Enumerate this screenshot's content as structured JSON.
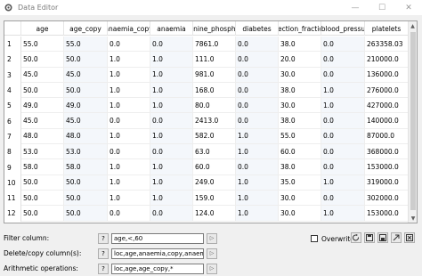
{
  "window": {
    "title": "Data Editor",
    "min": "—",
    "max": "☐",
    "close": "✕"
  },
  "columns": [
    "age",
    "age_copy",
    "anaemia_copy",
    "anaemia",
    "atinine_phosphok",
    "diabetes",
    "ejection_fraction",
    "h_blood_pressure",
    "platelets"
  ],
  "rows": [
    {
      "n": "1",
      "v": [
        "55.0",
        "55.0",
        "0.0",
        "0.0",
        "7861.0",
        "0.0",
        "38.0",
        "0.0",
        "263358.03"
      ]
    },
    {
      "n": "2",
      "v": [
        "50.0",
        "50.0",
        "1.0",
        "1.0",
        "111.0",
        "0.0",
        "20.0",
        "0.0",
        "210000.0"
      ]
    },
    {
      "n": "3",
      "v": [
        "45.0",
        "45.0",
        "1.0",
        "1.0",
        "981.0",
        "0.0",
        "30.0",
        "0.0",
        "136000.0"
      ]
    },
    {
      "n": "4",
      "v": [
        "50.0",
        "50.0",
        "1.0",
        "1.0",
        "168.0",
        "0.0",
        "38.0",
        "1.0",
        "276000.0"
      ]
    },
    {
      "n": "5",
      "v": [
        "49.0",
        "49.0",
        "1.0",
        "1.0",
        "80.0",
        "0.0",
        "30.0",
        "1.0",
        "427000.0"
      ]
    },
    {
      "n": "6",
      "v": [
        "45.0",
        "45.0",
        "0.0",
        "0.0",
        "2413.0",
        "0.0",
        "38.0",
        "0.0",
        "140000.0"
      ]
    },
    {
      "n": "7",
      "v": [
        "48.0",
        "48.0",
        "1.0",
        "1.0",
        "582.0",
        "1.0",
        "55.0",
        "0.0",
        "87000.0"
      ]
    },
    {
      "n": "8",
      "v": [
        "53.0",
        "53.0",
        "0.0",
        "0.0",
        "63.0",
        "1.0",
        "60.0",
        "0.0",
        "368000.0"
      ]
    },
    {
      "n": "9",
      "v": [
        "58.0",
        "58.0",
        "1.0",
        "1.0",
        "60.0",
        "0.0",
        "38.0",
        "0.0",
        "153000.0"
      ]
    },
    {
      "n": "10",
      "v": [
        "50.0",
        "50.0",
        "1.0",
        "1.0",
        "249.0",
        "1.0",
        "35.0",
        "1.0",
        "319000.0"
      ]
    },
    {
      "n": "11",
      "v": [
        "50.0",
        "50.0",
        "1.0",
        "1.0",
        "159.0",
        "1.0",
        "30.0",
        "0.0",
        "302000.0"
      ]
    },
    {
      "n": "12",
      "v": [
        "50.0",
        "50.0",
        "0.0",
        "0.0",
        "124.0",
        "1.0",
        "30.0",
        "1.0",
        "153000.0"
      ]
    }
  ],
  "controls": {
    "filter_label": "Filter column:",
    "filter_value": "age,<,60",
    "delete_label": "Delete/copy column(s):",
    "delete_value": "loc,age,anaemia,copy,anaemia",
    "arith_label": "Arithmetic operations:",
    "arith_value": "loc,age,age_copy,*",
    "help": "?",
    "run": "▷",
    "overwrite_label": "Overwrite"
  },
  "icons": [
    "refresh-icon",
    "save-icon",
    "import-icon",
    "export-icon",
    "close-panel-icon"
  ]
}
